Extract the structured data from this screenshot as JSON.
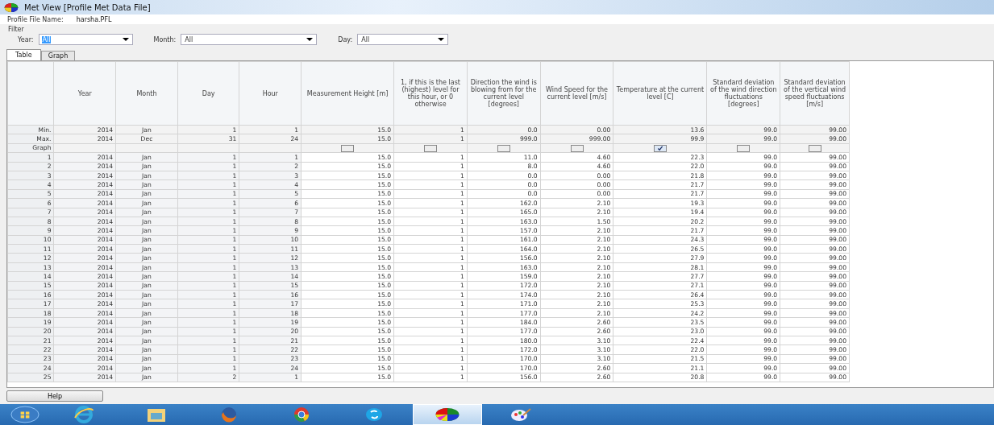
{
  "window": {
    "title": "Met View [Profile Met Data File]"
  },
  "profile_file": {
    "label": "Profile File Name:",
    "value": "harsha.PFL"
  },
  "filter": {
    "title": "Filter",
    "fields": [
      {
        "label": "Year:",
        "value": "All",
        "selected": true
      },
      {
        "label": "Month:",
        "value": "All",
        "selected": false
      },
      {
        "label": "Day:",
        "value": "All",
        "selected": false
      }
    ]
  },
  "tabs": [
    {
      "label": "Table",
      "selected": true
    },
    {
      "label": "Graph",
      "selected": false
    }
  ],
  "table": {
    "columns": [
      "Year",
      "Month",
      "Day",
      "Hour",
      "Measurement Height [m]",
      "1, if this is the last (highest) level for this hour, or 0 otherwise",
      "Direction the wind is blowing from for the current level [degrees]",
      "Wind Speed for the current level [m/s]",
      "Temperature at the current level [C]",
      "Standard deviation of the wind direction fluctuations [degrees]",
      "Standard deviation of the vertical wind speed fluctuations [m/s]"
    ],
    "min_row": {
      "label": "Min.",
      "cells": [
        "2014",
        "Jan",
        "1",
        "1",
        "15.0",
        "1",
        "0.0",
        "0.00",
        "13.6",
        "99.0",
        "99.00"
      ]
    },
    "max_row": {
      "label": "Max.",
      "cells": [
        "2014",
        "Dec",
        "31",
        "24",
        "15.0",
        "1",
        "999.0",
        "999.00",
        "99.9",
        "99.0",
        "99.00"
      ]
    },
    "graph_row": {
      "label": "Graph",
      "checkboxes": [
        {
          "checked": false
        },
        {
          "checked": false
        },
        {
          "checked": false
        },
        {
          "checked": false
        },
        {
          "checked": true
        },
        {
          "checked": false
        },
        {
          "checked": false
        }
      ]
    },
    "rows": [
      {
        "label": "1",
        "cells": [
          "2014",
          "Jan",
          "1",
          "1",
          "15.0",
          "1",
          "11.0",
          "4.60",
          "22.3",
          "99.0",
          "99.00"
        ]
      },
      {
        "label": "2",
        "cells": [
          "2014",
          "Jan",
          "1",
          "2",
          "15.0",
          "1",
          "8.0",
          "4.60",
          "22.0",
          "99.0",
          "99.00"
        ]
      },
      {
        "label": "3",
        "cells": [
          "2014",
          "Jan",
          "1",
          "3",
          "15.0",
          "1",
          "0.0",
          "0.00",
          "21.8",
          "99.0",
          "99.00"
        ]
      },
      {
        "label": "4",
        "cells": [
          "2014",
          "Jan",
          "1",
          "4",
          "15.0",
          "1",
          "0.0",
          "0.00",
          "21.7",
          "99.0",
          "99.00"
        ]
      },
      {
        "label": "5",
        "cells": [
          "2014",
          "Jan",
          "1",
          "5",
          "15.0",
          "1",
          "0.0",
          "0.00",
          "21.7",
          "99.0",
          "99.00"
        ]
      },
      {
        "label": "6",
        "cells": [
          "2014",
          "Jan",
          "1",
          "6",
          "15.0",
          "1",
          "162.0",
          "2.10",
          "19.3",
          "99.0",
          "99.00"
        ]
      },
      {
        "label": "7",
        "cells": [
          "2014",
          "Jan",
          "1",
          "7",
          "15.0",
          "1",
          "165.0",
          "2.10",
          "19.4",
          "99.0",
          "99.00"
        ]
      },
      {
        "label": "8",
        "cells": [
          "2014",
          "Jan",
          "1",
          "8",
          "15.0",
          "1",
          "163.0",
          "1.50",
          "20.2",
          "99.0",
          "99.00"
        ]
      },
      {
        "label": "9",
        "cells": [
          "2014",
          "Jan",
          "1",
          "9",
          "15.0",
          "1",
          "157.0",
          "2.10",
          "21.7",
          "99.0",
          "99.00"
        ]
      },
      {
        "label": "10",
        "cells": [
          "2014",
          "Jan",
          "1",
          "10",
          "15.0",
          "1",
          "161.0",
          "2.10",
          "24.3",
          "99.0",
          "99.00"
        ]
      },
      {
        "label": "11",
        "cells": [
          "2014",
          "Jan",
          "1",
          "11",
          "15.0",
          "1",
          "164.0",
          "2.10",
          "26.5",
          "99.0",
          "99.00"
        ]
      },
      {
        "label": "12",
        "cells": [
          "2014",
          "Jan",
          "1",
          "12",
          "15.0",
          "1",
          "156.0",
          "2.10",
          "27.9",
          "99.0",
          "99.00"
        ]
      },
      {
        "label": "13",
        "cells": [
          "2014",
          "Jan",
          "1",
          "13",
          "15.0",
          "1",
          "163.0",
          "2.10",
          "28.1",
          "99.0",
          "99.00"
        ]
      },
      {
        "label": "14",
        "cells": [
          "2014",
          "Jan",
          "1",
          "14",
          "15.0",
          "1",
          "159.0",
          "2.10",
          "27.7",
          "99.0",
          "99.00"
        ]
      },
      {
        "label": "15",
        "cells": [
          "2014",
          "Jan",
          "1",
          "15",
          "15.0",
          "1",
          "172.0",
          "2.10",
          "27.1",
          "99.0",
          "99.00"
        ]
      },
      {
        "label": "16",
        "cells": [
          "2014",
          "Jan",
          "1",
          "16",
          "15.0",
          "1",
          "174.0",
          "2.10",
          "26.4",
          "99.0",
          "99.00"
        ]
      },
      {
        "label": "17",
        "cells": [
          "2014",
          "Jan",
          "1",
          "17",
          "15.0",
          "1",
          "171.0",
          "2.10",
          "25.3",
          "99.0",
          "99.00"
        ]
      },
      {
        "label": "18",
        "cells": [
          "2014",
          "Jan",
          "1",
          "18",
          "15.0",
          "1",
          "177.0",
          "2.10",
          "24.2",
          "99.0",
          "99.00"
        ]
      },
      {
        "label": "19",
        "cells": [
          "2014",
          "Jan",
          "1",
          "19",
          "15.0",
          "1",
          "184.0",
          "2.60",
          "23.5",
          "99.0",
          "99.00"
        ]
      },
      {
        "label": "20",
        "cells": [
          "2014",
          "Jan",
          "1",
          "20",
          "15.0",
          "1",
          "177.0",
          "2.60",
          "23.0",
          "99.0",
          "99.00"
        ]
      },
      {
        "label": "21",
        "cells": [
          "2014",
          "Jan",
          "1",
          "21",
          "15.0",
          "1",
          "180.0",
          "3.10",
          "22.4",
          "99.0",
          "99.00"
        ]
      },
      {
        "label": "22",
        "cells": [
          "2014",
          "Jan",
          "1",
          "22",
          "15.0",
          "1",
          "172.0",
          "3.10",
          "22.0",
          "99.0",
          "99.00"
        ]
      },
      {
        "label": "23",
        "cells": [
          "2014",
          "Jan",
          "1",
          "23",
          "15.0",
          "1",
          "170.0",
          "3.10",
          "21.5",
          "99.0",
          "99.00"
        ]
      },
      {
        "label": "24",
        "cells": [
          "2014",
          "Jan",
          "1",
          "24",
          "15.0",
          "1",
          "170.0",
          "2.60",
          "21.1",
          "99.0",
          "99.00"
        ]
      },
      {
        "label": "25",
        "cells": [
          "2014",
          "Jan",
          "2",
          "1",
          "15.0",
          "1",
          "156.0",
          "2.60",
          "20.8",
          "99.0",
          "99.00"
        ]
      }
    ]
  },
  "buttons": [
    "Help"
  ],
  "taskbar": [
    {
      "kind": "start",
      "selected": false
    },
    {
      "kind": "browser",
      "selected": false
    },
    {
      "kind": "folder",
      "selected": false
    },
    {
      "kind": "fox",
      "selected": false
    },
    {
      "kind": "chrome",
      "selected": false
    },
    {
      "kind": "chat",
      "selected": false
    },
    {
      "kind": "wheel",
      "selected": true
    },
    {
      "kind": "paint",
      "selected": false
    }
  ]
}
